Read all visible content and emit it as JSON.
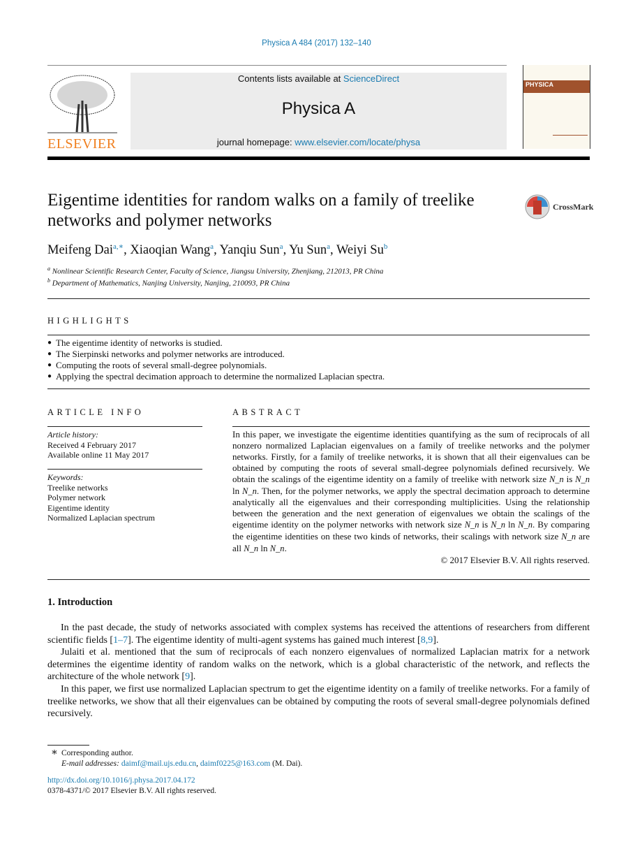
{
  "header": {
    "citation": "Physica A 484 (2017) 132–140",
    "contents_prefix": "Contents lists available at ",
    "contents_link": "ScienceDirect",
    "journal": "Physica A",
    "homepage_prefix": "journal homepage: ",
    "homepage_link": "www.elsevier.com/locate/physa",
    "publisher": "ELSEVIER",
    "cover_title": "PHYSICA"
  },
  "colors": {
    "link": "#1a7bb0",
    "elsevier_orange": "#f07f1e",
    "banner_bg": "#ececec"
  },
  "title": "Eigentime identities for random walks on a family of treelike networks and polymer networks",
  "crossmark": "CrossMark",
  "authors": [
    {
      "name": "Meifeng Dai",
      "sup": "a,∗"
    },
    {
      "name": "Xiaoqian Wang",
      "sup": "a"
    },
    {
      "name": "Yanqiu Sun",
      "sup": "a"
    },
    {
      "name": "Yu Sun",
      "sup": "a"
    },
    {
      "name": "Weiyi Su",
      "sup": "b"
    }
  ],
  "affiliations": [
    {
      "sup": "a",
      "text": "Nonlinear Scientific Research Center, Faculty of Science, Jiangsu University, Zhenjiang, 212013, PR China"
    },
    {
      "sup": "b",
      "text": "Department of Mathematics, Nanjing University, Nanjing, 210093, PR China"
    }
  ],
  "highlights": {
    "heading": "HIGHLIGHTS",
    "items": [
      "The eigentime identity of networks is studied.",
      "The Sierpinski networks and polymer networks are introduced.",
      "Computing the roots of several small-degree polynomials.",
      "Applying the spectral decimation approach to determine the normalized Laplacian spectra."
    ]
  },
  "article_info": {
    "heading": "ARTICLE INFO",
    "history_label": "Article history:",
    "received": "Received 4 February 2017",
    "online": "Available online 11 May 2017",
    "keywords_label": "Keywords:",
    "keywords": [
      "Treelike networks",
      "Polymer network",
      "Eigentime identity",
      "Normalized Laplacian spectrum"
    ]
  },
  "abstract": {
    "heading": "ABSTRACT",
    "segments": [
      {
        "t": "In this paper, we investigate the eigentime identities quantifying as the sum of reciprocals of all nonzero normalized Laplacian eigenvalues on a family of treelike networks and the polymer networks. Firstly, for a family of treelike networks, it is shown that all their eigenvalues can be obtained by computing the roots of several small-degree polynomials defined recursively. We obtain the scalings of the eigentime identity on a family of treelike with network size "
      },
      {
        "m": "N_n"
      },
      {
        "t": " is "
      },
      {
        "m": "N_n"
      },
      {
        "t": " ln "
      },
      {
        "m": "N_n"
      },
      {
        "t": ". Then, for the polymer networks, we apply the spectral decimation approach to determine analytically all the eigenvalues and their corresponding multiplicities. Using the relationship between the generation and the next generation of eigenvalues we obtain the scalings of the eigentime identity on the polymer networks with network size "
      },
      {
        "m": "N_n"
      },
      {
        "t": " is "
      },
      {
        "m": "N_n"
      },
      {
        "t": " ln "
      },
      {
        "m": "N_n"
      },
      {
        "t": ". By comparing the eigentime identities on these two kinds of networks, their scalings with network size "
      },
      {
        "m": "N_n"
      },
      {
        "t": " are all "
      },
      {
        "m": "N_n"
      },
      {
        "t": " ln "
      },
      {
        "m": "N_n"
      },
      {
        "t": "."
      }
    ],
    "copyright": "© 2017 Elsevier B.V. All rights reserved."
  },
  "introduction": {
    "heading": "1.  Introduction",
    "paragraphs": [
      [
        {
          "t": "In the past decade, the study of networks associated with complex systems has received the attentions of researchers from different scientific fields ["
        },
        {
          "l": "1–7"
        },
        {
          "t": "]. The eigentime identity of multi-agent systems has gained much interest ["
        },
        {
          "l": "8,9"
        },
        {
          "t": "]."
        }
      ],
      [
        {
          "t": "Julaiti et al. mentioned that the sum of reciprocals of each nonzero eigenvalues of normalized Laplacian matrix for a network determines the eigentime identity of random walks on the network, which is a global characteristic of the network, and reflects the architecture of the whole network ["
        },
        {
          "l": "9"
        },
        {
          "t": "]."
        }
      ],
      [
        {
          "t": "In this paper, we first use normalized Laplacian spectrum to get the eigentime identity on a family of treelike networks. For a family of treelike networks, we show that all their eigenvalues can be obtained by computing the roots of several small-degree polynomials defined recursively."
        }
      ]
    ]
  },
  "footnotes": {
    "star": "∗",
    "corresponding": "Corresponding author.",
    "email_label": "E-mail addresses: ",
    "email1": "daimf@mail.ujs.edu.cn",
    "email2": "daimf0225@163.com",
    "email_suffix": " (M. Dai).",
    "doi": "http://dx.doi.org/10.1016/j.physa.2017.04.172",
    "issn": "0378-4371/© 2017 Elsevier B.V. All rights reserved."
  }
}
